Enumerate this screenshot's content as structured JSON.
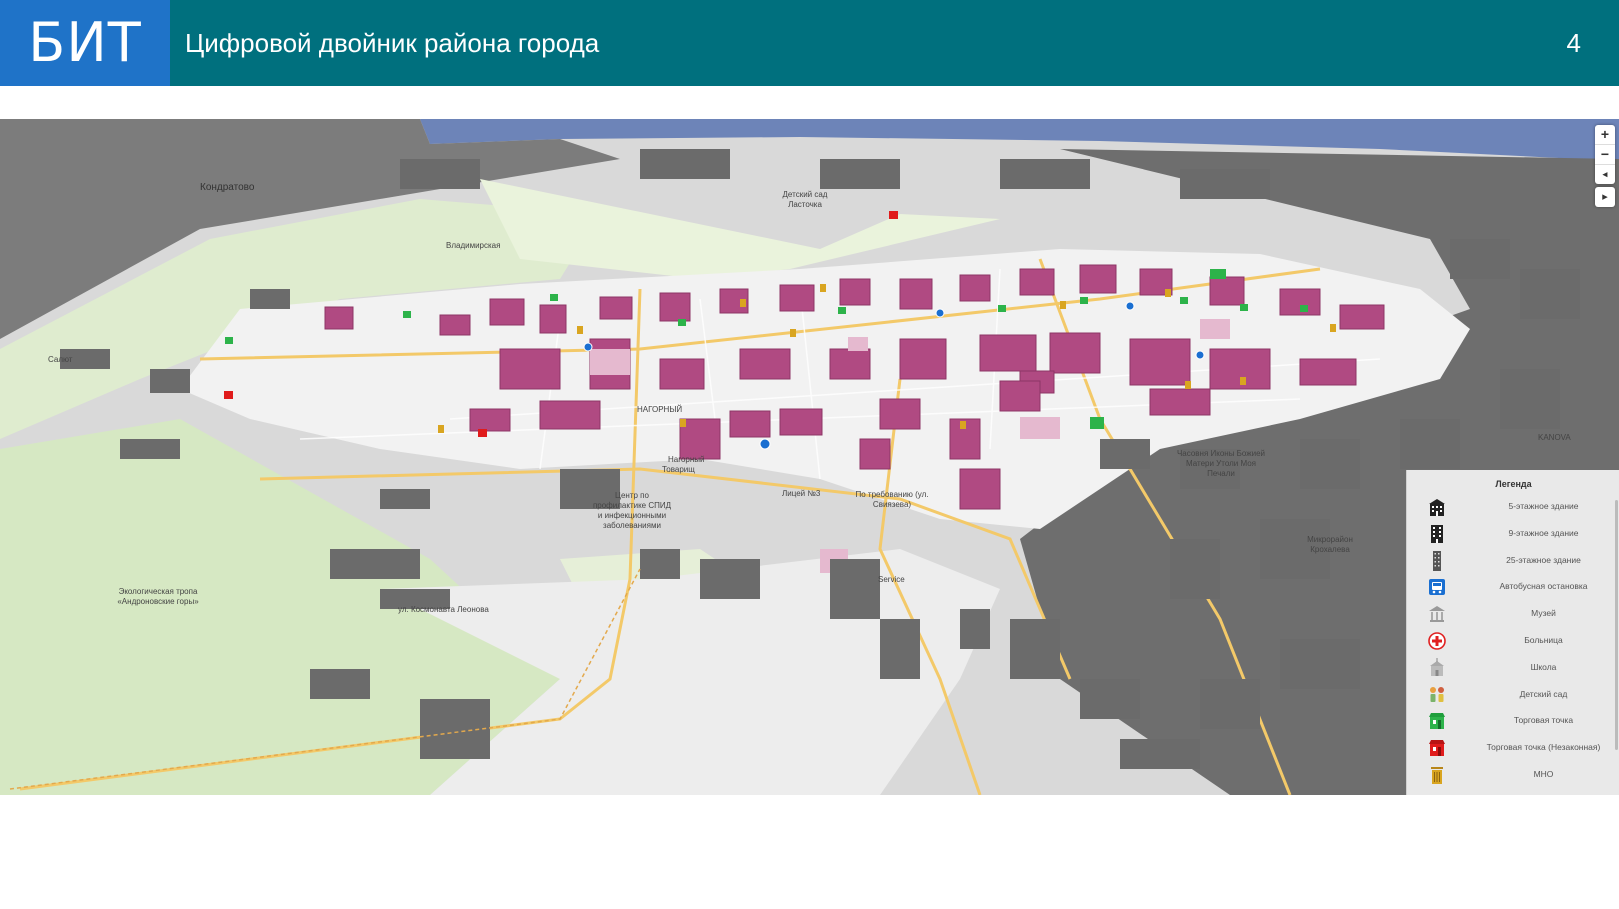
{
  "header": {
    "logo": "БИТ",
    "title": "Цифровой двойник района города",
    "page_number": "4"
  },
  "map": {
    "zoom_in_label": "+",
    "zoom_out_label": "−",
    "compass_label": "◂",
    "layers_label": "▸",
    "labels": {
      "kondratovo": "Кондратово",
      "salyut": "Салют",
      "vladimirskaya": "Владимирская",
      "ecotrail": "Экологическая тропа «Андроновские горы»",
      "nagorny": "НАГОРНЫЙ",
      "lyceum": "Лицей №3",
      "on_demand": "По требованию (ул. Свиязева)",
      "chapel": "Часовня Иконы Божией Матери Утоли Моя Печали",
      "microdistrict": "Микрорайон Крохалева",
      "aids": "Центр по профилактике СПИД и инфекционными заболеваниями",
      "detsky_sad": "Детский сад Ласточка",
      "kosmonavtov": "ул. Космонавта Леонова",
      "service": "Service",
      "tovarishch": "Товарищ",
      "nagorny_stop": "Нагорный",
      "kanova": "KANOVA"
    }
  },
  "legend": {
    "title": "Легенда",
    "items": [
      {
        "label": "5-этажное здание",
        "icon": "building-5-icon"
      },
      {
        "label": "9-этажное здание",
        "icon": "building-9-icon"
      },
      {
        "label": "25-этажное здание",
        "icon": "building-25-icon"
      },
      {
        "label": "Автобусная остановка",
        "icon": "bus-stop-icon"
      },
      {
        "label": "Музей",
        "icon": "museum-icon"
      },
      {
        "label": "Больница",
        "icon": "hospital-icon"
      },
      {
        "label": "Школа",
        "icon": "school-icon"
      },
      {
        "label": "Детский сад",
        "icon": "kindergarten-icon"
      },
      {
        "label": "Торговая точка",
        "icon": "shop-icon"
      },
      {
        "label": "Торговая точка (Незаконная)",
        "icon": "illegal-shop-icon"
      },
      {
        "label": "МНО",
        "icon": "trash-icon"
      }
    ]
  },
  "colors": {
    "header": "#00707e",
    "logo": "#1f73c8",
    "district": "#b04a82",
    "shop": "#2db34a",
    "illegal": "#e01b1b",
    "bus": "#1a6fd1",
    "trash": "#d9a520"
  }
}
